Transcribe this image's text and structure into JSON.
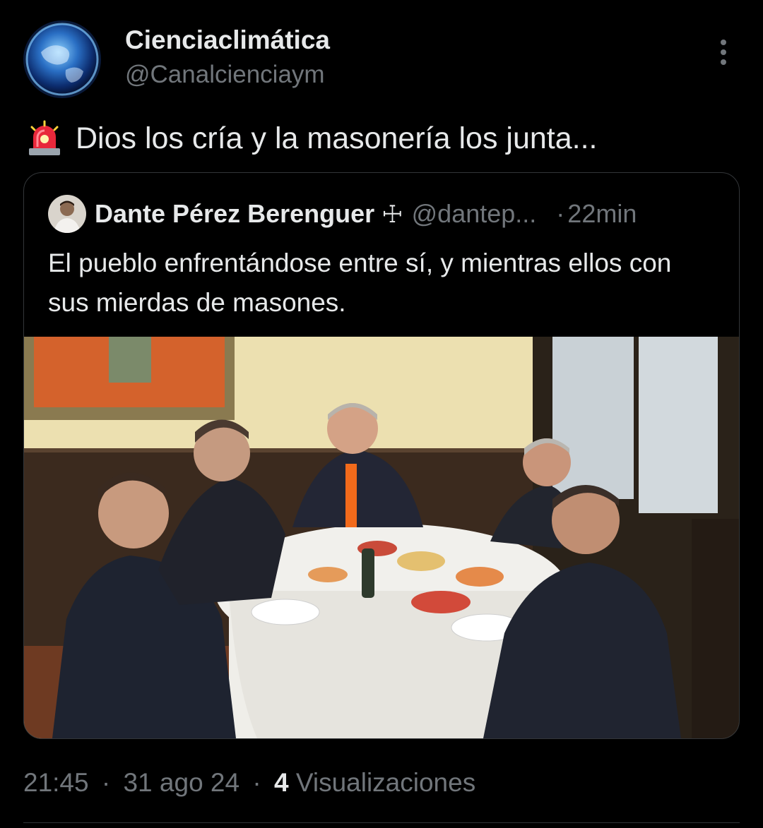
{
  "author": {
    "name": "Cienciaclimática",
    "handle": "@Canalcienciaym"
  },
  "tweet": {
    "icon": "police-siren-icon",
    "text": "Dios los cría y la masonería los junta..."
  },
  "quoted_tweet": {
    "author_name": "Dante Pérez Berenguer",
    "name_symbol": "☩",
    "handle": "@dantep...",
    "separator": "·",
    "time": "22min",
    "text": "El pueblo enfrentándose entre sí, y mientras ellos con sus mierdas de masones."
  },
  "meta": {
    "time": "21:45",
    "date": "31 ago 24",
    "views_count": "4",
    "views_label": "Visualizaciones",
    "separator": "·"
  },
  "colors": {
    "background": "#000000",
    "text": "#e7e9ea",
    "muted": "#71767b",
    "border": "#333639"
  }
}
